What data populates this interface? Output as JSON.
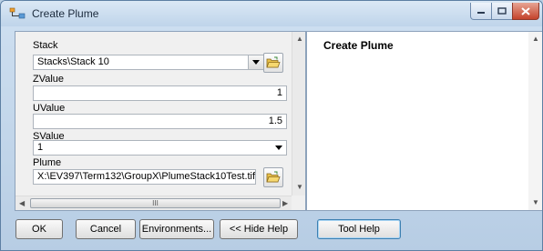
{
  "window": {
    "title": "Create Plume"
  },
  "params": [
    {
      "label": "Stack",
      "value": "Stacks\\Stack 10"
    },
    {
      "label": "ZValue",
      "value": "1"
    },
    {
      "label": "UValue",
      "value": "1.5"
    },
    {
      "label": "SValue",
      "value": "1"
    },
    {
      "label": "Plume",
      "value": "X:\\EV397\\Term132\\GroupX\\PlumeStack10Test.tif"
    }
  ],
  "help": {
    "title": "Create Plume"
  },
  "buttons": {
    "ok": "OK",
    "cancel": "Cancel",
    "environments": "Environments...",
    "hide_help": "<< Hide Help",
    "tool_help": "Tool Help"
  },
  "scrollbar": {
    "thumb_grip": "III"
  },
  "icons": {
    "app": "tool-icon",
    "browse": "open-folder-icon",
    "dropdown": "chevron-down-icon"
  },
  "colors": {
    "title_bar": "#c5d8ec",
    "close_button": "#c4432c",
    "panel_border": "#8da2bb"
  }
}
